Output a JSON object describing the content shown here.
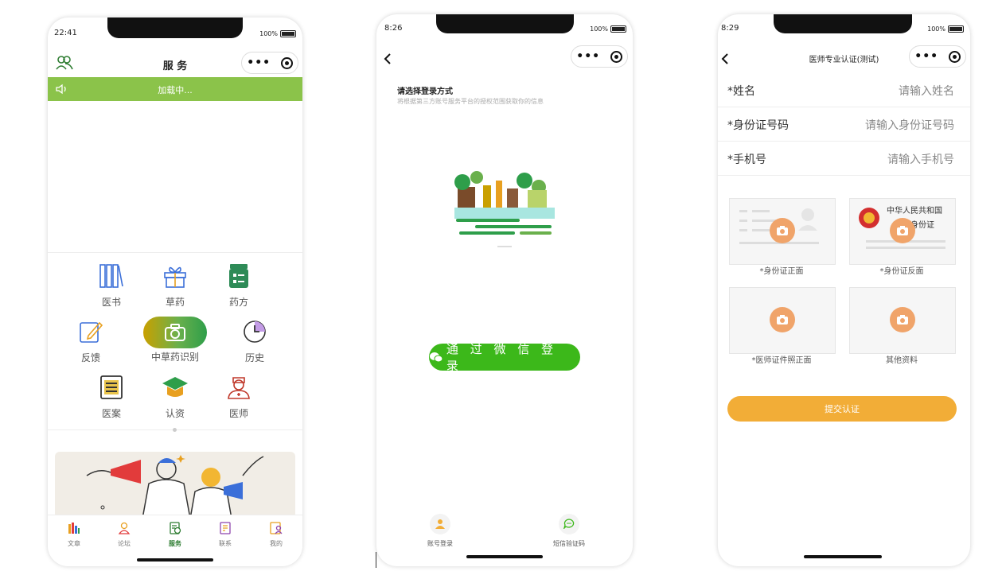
{
  "phone1": {
    "time": "22:41",
    "battery": "100%",
    "title": "服 务",
    "banner_text": "加载中...",
    "grid": [
      {
        "label": "医书",
        "icon": "books-icon"
      },
      {
        "label": "草药",
        "icon": "gift-icon"
      },
      {
        "label": "药方",
        "icon": "prescription-icon"
      },
      {
        "label": "反馈",
        "icon": "edit-icon"
      },
      {
        "label": "中草药识别",
        "icon": "camera-icon"
      },
      {
        "label": "历史",
        "icon": "history-icon"
      },
      {
        "label": "医案",
        "icon": "case-list-icon"
      },
      {
        "label": "认资",
        "icon": "graduation-cap-icon"
      },
      {
        "label": "医师",
        "icon": "doctor-icon"
      }
    ],
    "tabs": [
      {
        "label": "文章",
        "icon": "article-icon"
      },
      {
        "label": "论坛",
        "icon": "forum-icon"
      },
      {
        "label": "服务",
        "icon": "service-icon",
        "active": true
      },
      {
        "label": "联系",
        "icon": "contact-icon"
      },
      {
        "label": "我的",
        "icon": "profile-icon"
      }
    ],
    "colors": {
      "banner": "#8bc34a",
      "active_tab": "#2e7d32"
    }
  },
  "phone2": {
    "time": "8:26",
    "battery": "100%",
    "heading": "请选择登录方式",
    "subheading": "将根据第三方账号服务平台的授权范围获取你的信息",
    "wechat_button": "通 过 微 信 登 录",
    "alt_logins": [
      {
        "label": "账号登录",
        "icon": "user-icon"
      },
      {
        "label": "短信验证码",
        "icon": "sms-icon"
      }
    ],
    "colors": {
      "wechat": "#3cb81a"
    }
  },
  "phone3": {
    "time": "8:29",
    "battery": "100%",
    "title": "医师专业认证(测试)",
    "fields": [
      {
        "label": "*姓名",
        "placeholder": "请输入姓名"
      },
      {
        "label": "*身份证号码",
        "placeholder": "请输入身份证号码"
      },
      {
        "label": "*手机号",
        "placeholder": "请输入手机号"
      }
    ],
    "uploads": [
      {
        "label": "*身份证正面"
      },
      {
        "label": "*身份证反面",
        "card_text_1": "中华人民共和国",
        "card_text_2": "居民身份证"
      },
      {
        "label": "*医师证件照正面"
      },
      {
        "label": "其他资料"
      }
    ],
    "submit": "提交认证",
    "colors": {
      "submit": "#f2ad37",
      "camera": "#f0a46a"
    }
  }
}
